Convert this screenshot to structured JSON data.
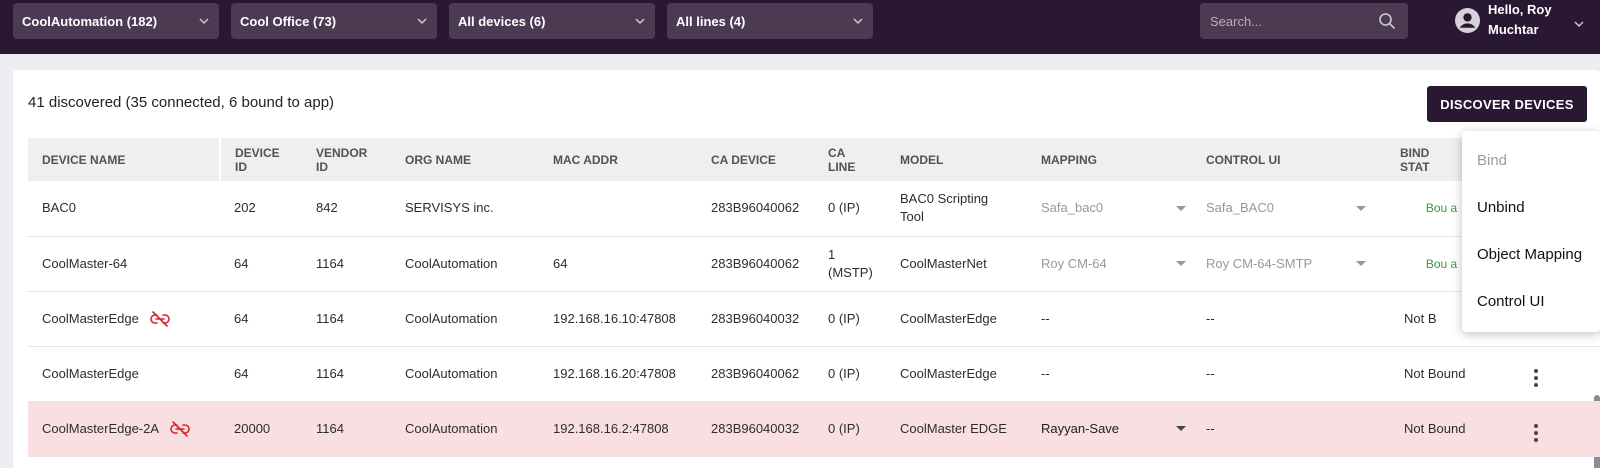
{
  "header": {
    "selectors": [
      {
        "label": "CoolAutomation (182)"
      },
      {
        "label": "Cool Office (73)"
      },
      {
        "label": "All devices (6)"
      },
      {
        "label": "All lines (4)"
      }
    ],
    "search_placeholder": "Search...",
    "greeting": "Hello, Roy Muchtar"
  },
  "main": {
    "summary": "41 discovered (35 connected, 6 bound to app)",
    "discover_label": "DISCOVER DEVICES"
  },
  "table": {
    "headers": [
      "DEVICE NAME",
      "DEVICE ID",
      "VENDOR ID",
      "ORG NAME",
      "MAC ADDR",
      "CA DEVICE",
      "CA LINE",
      "MODEL",
      "MAPPING",
      "CONTROL UI",
      "BIND STAT"
    ],
    "rows": [
      {
        "name": "BAC0",
        "device_id": "202",
        "vendor_id": "842",
        "org": "SERVISYS inc.",
        "mac": "",
        "ca_device": "283B96040062",
        "ca_line": "0 (IP)",
        "model": "BAC0 Scripting Tool",
        "mapping": "Safa_bac0",
        "control_ui": "Safa_BAC0",
        "status": "Bou a"
      },
      {
        "name": "CoolMaster-64",
        "device_id": "64",
        "vendor_id": "1164",
        "org": "CoolAutomation",
        "mac": "64",
        "ca_device": "283B96040062",
        "ca_line": "1 (MSTP)",
        "model": "CoolMasterNet",
        "mapping": "Roy CM-64",
        "control_ui": "Roy CM-64-SMTP",
        "status": "Bou a"
      },
      {
        "name": "CoolMasterEdge",
        "device_id": "64",
        "vendor_id": "1164",
        "org": "CoolAutomation",
        "mac": "192.168.16.10:47808",
        "ca_device": "283B96040032",
        "ca_line": "0 (IP)",
        "model": "CoolMasterEdge",
        "mapping": "--",
        "control_ui": "--",
        "status": "Not B"
      },
      {
        "name": "CoolMasterEdge",
        "device_id": "64",
        "vendor_id": "1164",
        "org": "CoolAutomation",
        "mac": "192.168.16.20:47808",
        "ca_device": "283B96040062",
        "ca_line": "0 (IP)",
        "model": "CoolMasterEdge",
        "mapping": "--",
        "control_ui": "--",
        "status": "Not Bound"
      },
      {
        "name": "CoolMasterEdge-2A",
        "device_id": "20000",
        "vendor_id": "1164",
        "org": "CoolAutomation",
        "mac": "192.168.16.2:47808",
        "ca_device": "283B96040032",
        "ca_line": "0 (IP)",
        "model": "CoolMaster EDGE",
        "mapping": "Rayyan-Save",
        "control_ui": "--",
        "status": "Not Bound"
      }
    ]
  },
  "context_menu": {
    "items": [
      {
        "label": "Bind"
      },
      {
        "label": "Unbind"
      },
      {
        "label": "Object Mapping"
      },
      {
        "label": "Control UI"
      }
    ]
  },
  "colors": {
    "topbar": "#2a1731",
    "selector_bg": "#4c3a52",
    "alert_row": "#f9dfe1",
    "unlink_icon": "#d9232b",
    "bound_text": "#3b9a3b"
  },
  "icons": [
    "chevron-down-icon",
    "search-icon",
    "user-avatar-icon",
    "unlink-icon",
    "more-vert-icon"
  ]
}
